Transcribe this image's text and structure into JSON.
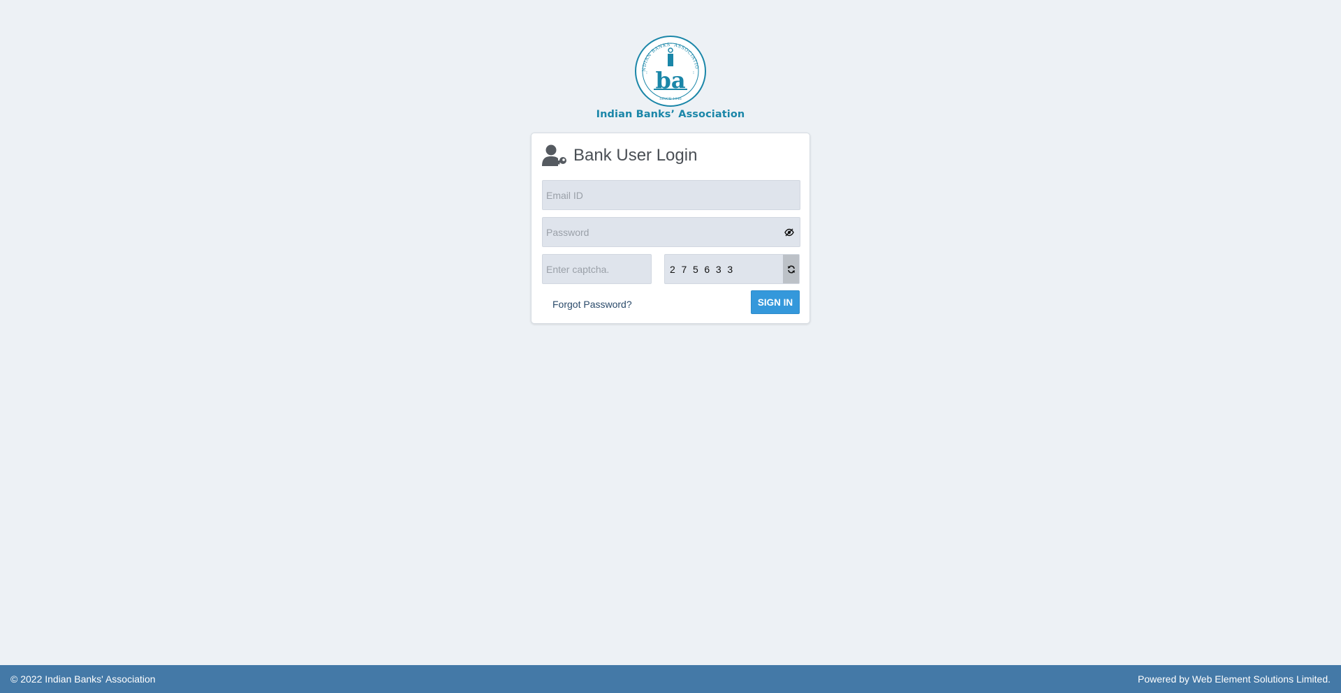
{
  "brand": {
    "logo_icon": "iba-seal-logo",
    "logo_ring_text": "INDIAN BANKS' ASSOCIATION",
    "logo_monogram": "iba",
    "logo_since": "SINCE 1946",
    "name": "Indian Banks’ Association",
    "color": "#1a86a8"
  },
  "login": {
    "icon": "user-key-icon",
    "title": "Bank User Login",
    "email_placeholder": "Email ID",
    "password_placeholder": "Password",
    "password_toggle_icon": "eye-slash-icon",
    "captcha_placeholder": "Enter captcha.",
    "captcha_code": "2 7 5 6 3 3",
    "refresh_icon": "refresh-icon",
    "forgot_label": "Forgot Password?",
    "signin_label": "SIGN IN",
    "signin_color": "#3498db"
  },
  "footer": {
    "copyright": "© 2022 Indian Banks' Association",
    "powered_by": "Powered by Web Element Solutions Limited.",
    "color": "#4479a7"
  }
}
